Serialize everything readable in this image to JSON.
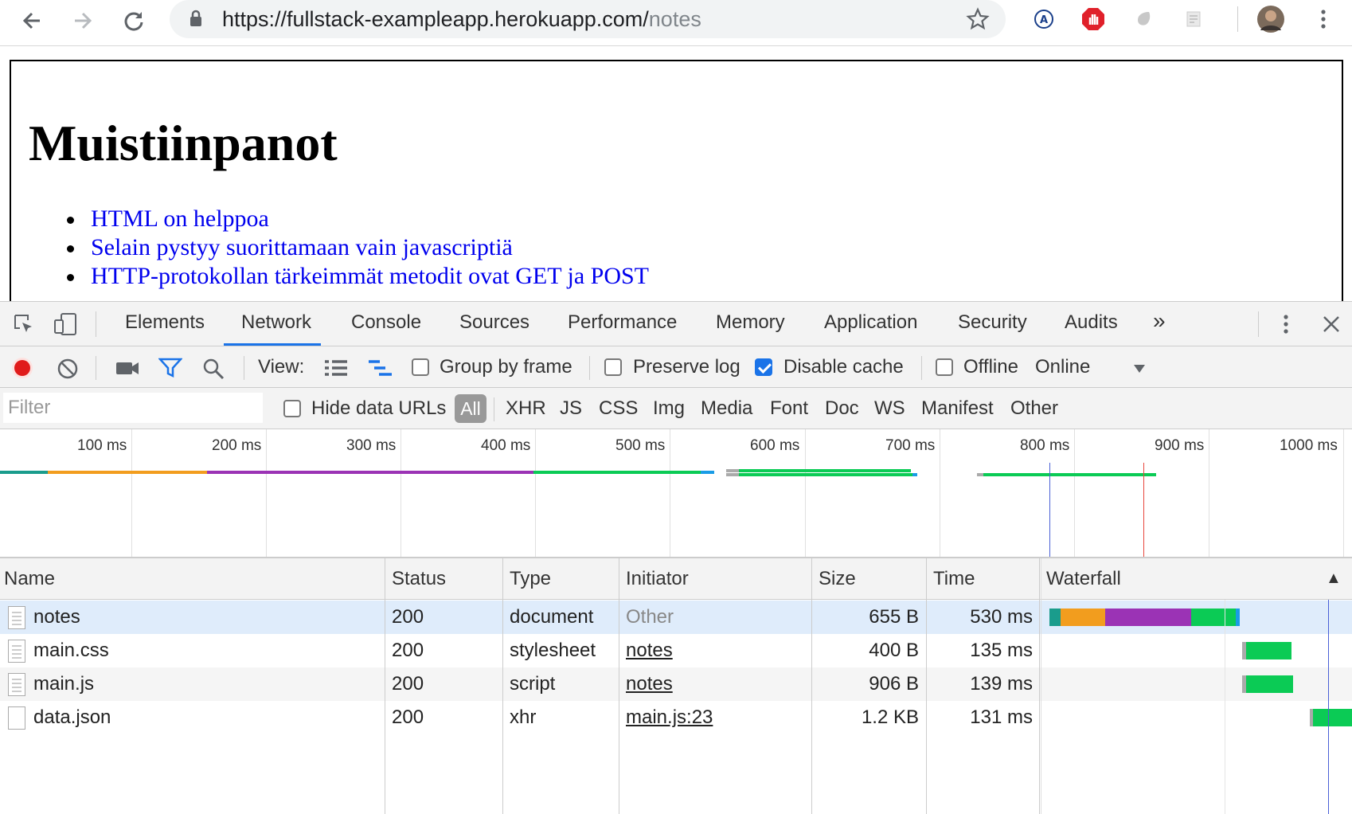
{
  "browser": {
    "url_base": "https://fullstack-exampleapp.herokuapp.com/",
    "url_path": "notes"
  },
  "page": {
    "heading": "Muistiinpanot",
    "notes": [
      "HTML on helppoa",
      "Selain pystyy suorittamaan vain javascriptiä",
      "HTTP-protokollan tärkeimmät metodit ovat GET ja POST"
    ]
  },
  "devtools": {
    "tabs": [
      "Elements",
      "Network",
      "Console",
      "Sources",
      "Performance",
      "Memory",
      "Application",
      "Security",
      "Audits"
    ],
    "more_tabs": "»",
    "active_tab": "Network",
    "toolbar": {
      "view_label": "View:",
      "group_by_frame": "Group by frame",
      "preserve_log": "Preserve log",
      "disable_cache": "Disable cache",
      "disable_cache_checked": true,
      "offline": "Offline",
      "throttling": "Online"
    },
    "filter_bar": {
      "placeholder": "Filter",
      "hide_data_urls": "Hide data URLs",
      "types": [
        "All",
        "XHR",
        "JS",
        "CSS",
        "Img",
        "Media",
        "Font",
        "Doc",
        "WS",
        "Manifest",
        "Other"
      ],
      "active_type": "All"
    },
    "overview_ticks": [
      "100 ms",
      "200 ms",
      "300 ms",
      "400 ms",
      "500 ms",
      "600 ms",
      "700 ms",
      "800 ms",
      "900 ms",
      "1000 ms"
    ],
    "columns": [
      "Name",
      "Status",
      "Type",
      "Initiator",
      "Size",
      "Time",
      "Waterfall"
    ],
    "sort_indicator": "▲",
    "requests": [
      {
        "name": "notes",
        "status": "200",
        "type": "document",
        "initiator": "Other",
        "size": "655 B",
        "time": "530 ms"
      },
      {
        "name": "main.css",
        "status": "200",
        "type": "stylesheet",
        "initiator": "notes",
        "size": "400 B",
        "time": "135 ms"
      },
      {
        "name": "main.js",
        "status": "200",
        "type": "script",
        "initiator": "notes",
        "size": "906 B",
        "time": "139 ms"
      },
      {
        "name": "data.json",
        "status": "200",
        "type": "xhr",
        "initiator": "main.js:23",
        "size": "1.2 KB",
        "time": "131 ms"
      }
    ],
    "colors": {
      "waiting": "#1a9c8c",
      "stalled": "#f29d1e",
      "ttfb": "#9b33b5",
      "download": "#0bcb55",
      "dom_content_loaded": "#4a5fd6",
      "load": "#e8453c"
    }
  }
}
